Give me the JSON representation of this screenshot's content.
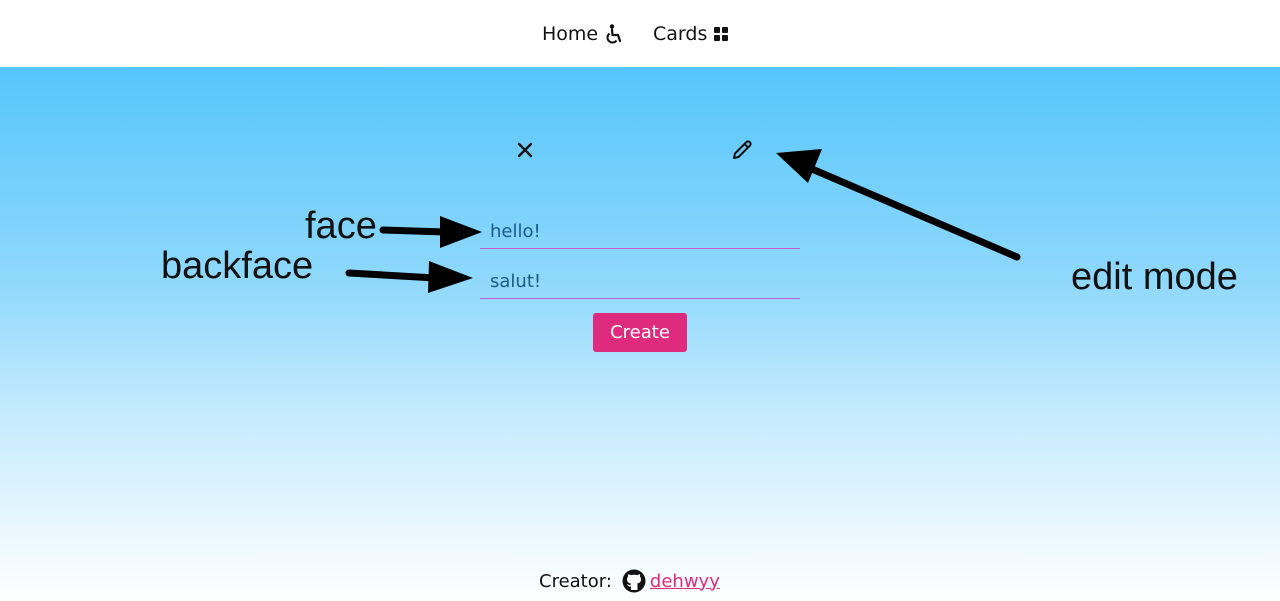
{
  "nav": {
    "home_label": "Home",
    "home_icon": "wheelchair-icon",
    "cards_label": "Cards",
    "cards_icon": "grid-icon"
  },
  "card_editor": {
    "close_icon": "close-icon",
    "edit_icon": "pencil-icon",
    "face_value": "hello!",
    "backface_value": "salut!",
    "create_label": "Create"
  },
  "annotations": {
    "face": "face",
    "backface": "backface",
    "edit_mode": "edit mode"
  },
  "footer": {
    "creator_label": "Creator:",
    "github_icon": "github-icon",
    "creator_link": "dehwyy"
  },
  "colors": {
    "accent": "#de2b7e",
    "gradient_top": "#55c6fb",
    "input_underline": "#c55bd6",
    "input_text": "#1b5c85"
  }
}
